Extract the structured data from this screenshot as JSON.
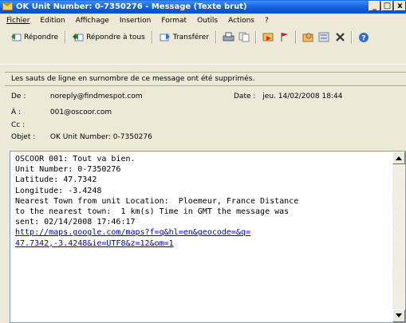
{
  "window": {
    "title": "OK Unit Number: 0-7350276 - Message (Texte brut)",
    "buttons": [
      "_",
      "□",
      "x"
    ]
  },
  "menu": {
    "items": [
      "Fichier",
      "Edition",
      "Affichage",
      "Insertion",
      "Format",
      "Outils",
      "Actions",
      "?"
    ]
  },
  "toolbar": {
    "reply": "Répondre",
    "reply_all": "Répondre à tous",
    "forward": "Transférer"
  },
  "infobar": {
    "text": "Les sauts de ligne en surnombre de ce message ont été supprimés."
  },
  "header": {
    "from_label": "De :",
    "from_value": "noreply@findmespot.com",
    "date_label": "Date :",
    "date_value": "jeu. 14/02/2008 18:44",
    "to_label": "À :",
    "to_value": "001@oscoor.com",
    "cc_label": "Cc :",
    "cc_value": "",
    "subject_label": "Objet :",
    "subject_value": "OK Unit Number: 0-7350276"
  },
  "message": {
    "line1": "OSCOOR 001: Tout va bien.",
    "line2": "Unit Number: 0-7350276",
    "line3": "Latitude: 47.7342",
    "line4": "Longitude: -3.4248",
    "line5": "Nearest Town from unit Location:  Ploemeur, France Distance",
    "line6": "to the nearest town:  1 km(s) Time in GMT the message was",
    "line7": "sent: 02/14/2008 17:46:17",
    "link1": "http://maps.google.com/maps?f=q&hl=en&geocode=&q=",
    "link2": "47.7342,-3.4248&ie=UTF8&z=12&om=1"
  }
}
